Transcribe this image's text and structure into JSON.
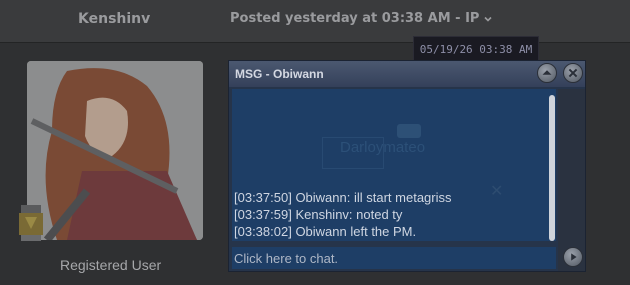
{
  "header": {
    "username": "Kenshinv",
    "posted": "Posted yesterday at 03:38 AM - IP",
    "tooltip": "05/19/26 03:38  AM"
  },
  "profile": {
    "role": "Registered User"
  },
  "chat": {
    "title": "MSG - Obiwann",
    "background_text": "Darloymateo",
    "messages": [
      "[03:37:50] Obiwann: ill start metagriss",
      "[03:37:59] Kenshinv: noted ty",
      "[03:38:02] Obiwann left the PM."
    ],
    "input_placeholder": "Click here to chat."
  },
  "icons": {
    "posted_menu": "chevron-down-icon",
    "chat_up": "arrow-up-icon",
    "chat_close": "close-icon",
    "chat_send": "play-arrow-icon",
    "rank_badge": "trophy-badge-icon"
  },
  "colors": {
    "page_bg": "#2f3032",
    "chat_bg": "#1e3e66",
    "text_muted": "#9a9b9e"
  }
}
